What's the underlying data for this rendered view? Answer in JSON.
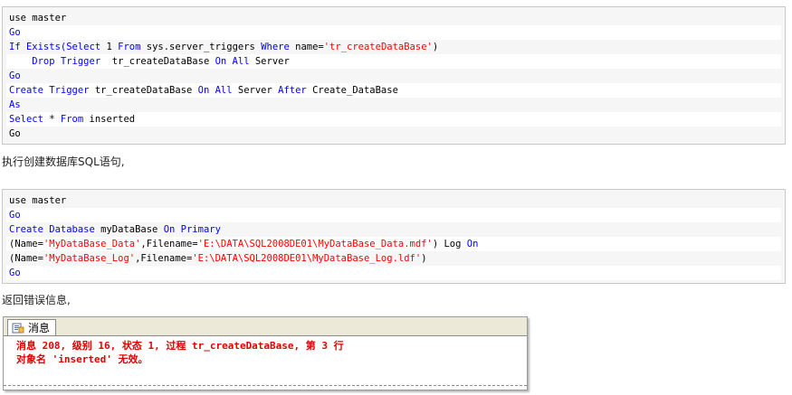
{
  "code_block_1": {
    "lines": [
      [
        {
          "t": "use master",
          "c": "plain"
        }
      ],
      [
        {
          "t": "Go",
          "c": "kw"
        }
      ],
      [
        {
          "t": "If Exists(Select",
          "c": "kw"
        },
        {
          "t": " 1 ",
          "c": "plain"
        },
        {
          "t": "From",
          "c": "kw"
        },
        {
          "t": " sys.server_triggers ",
          "c": "plain"
        },
        {
          "t": "Where",
          "c": "kw"
        },
        {
          "t": " name=",
          "c": "plain"
        },
        {
          "t": "'tr_createDataBase'",
          "c": "str"
        },
        {
          "t": ")",
          "c": "plain"
        }
      ],
      [
        {
          "t": "    Drop Trigger",
          "c": "kw"
        },
        {
          "t": "  tr_createDataBase ",
          "c": "plain"
        },
        {
          "t": "On All",
          "c": "kw"
        },
        {
          "t": " Server",
          "c": "plain"
        }
      ],
      [
        {
          "t": "Go",
          "c": "kw"
        }
      ],
      [
        {
          "t": "Create Trigger",
          "c": "kw"
        },
        {
          "t": " tr_createDataBase ",
          "c": "plain"
        },
        {
          "t": "On All",
          "c": "kw"
        },
        {
          "t": " Server ",
          "c": "plain"
        },
        {
          "t": "After",
          "c": "kw"
        },
        {
          "t": " Create_DataBase",
          "c": "plain"
        }
      ],
      [
        {
          "t": "As",
          "c": "kw"
        }
      ],
      [
        {
          "t": "Select",
          "c": "kw"
        },
        {
          "t": " * ",
          "c": "plain"
        },
        {
          "t": "From",
          "c": "kw"
        },
        {
          "t": " inserted",
          "c": "plain"
        }
      ],
      [
        {
          "t": "Go",
          "c": "plain"
        }
      ]
    ]
  },
  "text_1": "执行创建数据库SQL语句,",
  "code_block_2": {
    "lines": [
      [
        {
          "t": "use master",
          "c": "plain"
        }
      ],
      [
        {
          "t": "Go",
          "c": "kw"
        }
      ],
      [
        {
          "t": "Create Database",
          "c": "kw"
        },
        {
          "t": " myDataBase ",
          "c": "plain"
        },
        {
          "t": "On Primary",
          "c": "kw"
        }
      ],
      [
        {
          "t": "(Name=",
          "c": "plain"
        },
        {
          "t": "'MyDataBase_Data'",
          "c": "str"
        },
        {
          "t": ",Filename=",
          "c": "plain"
        },
        {
          "t": "'E:\\DATA\\SQL2008DE01\\MyDataBase_Data.mdf'",
          "c": "str"
        },
        {
          "t": ") Log ",
          "c": "plain"
        },
        {
          "t": "On",
          "c": "kw"
        }
      ],
      [
        {
          "t": "(Name=",
          "c": "plain"
        },
        {
          "t": "'MyDataBase_Log'",
          "c": "str"
        },
        {
          "t": ",Filename=",
          "c": "plain"
        },
        {
          "t": "'E:\\DATA\\SQL2008DE01\\MyDataBase_Log.ldf'",
          "c": "str"
        },
        {
          "t": ")",
          "c": "plain"
        }
      ],
      [
        {
          "t": "Go",
          "c": "kw"
        }
      ]
    ]
  },
  "text_2": "返回错误信息,",
  "messages_panel": {
    "tab_label": "消息",
    "lines": [
      "消息 208, 级别 16, 状态 1, 过程 tr_createDataBase, 第 3 行",
      "对象名 'inserted' 无效。"
    ]
  },
  "colors": {
    "keyword": "#0000ff",
    "string": "#ff0000",
    "error": "#e00000"
  }
}
